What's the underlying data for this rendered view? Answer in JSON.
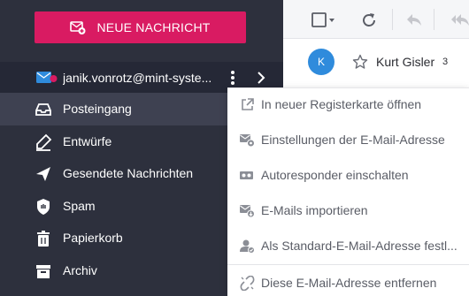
{
  "sidebar": {
    "new_message_label": "NEUE NACHRICHT",
    "account_email": "janik.vonrotz@mint-syste...",
    "items": [
      {
        "label": "Posteingang",
        "icon": "inbox-icon",
        "active": true
      },
      {
        "label": "Entwürfe",
        "icon": "drafts-icon",
        "active": false
      },
      {
        "label": "Gesendete Nachrichten",
        "icon": "send-icon",
        "active": false
      },
      {
        "label": "Spam",
        "icon": "hand-stop-icon",
        "active": false
      },
      {
        "label": "Papierkorb",
        "icon": "trash-icon",
        "active": false
      },
      {
        "label": "Archiv",
        "icon": "archive-icon",
        "active": false
      }
    ]
  },
  "message_list": {
    "first_row": {
      "avatar_letter": "K",
      "sender": "Kurt Gisler",
      "count": "3"
    }
  },
  "account_menu": {
    "items": [
      {
        "label": "In neuer Registerkarte öffnen",
        "icon": "external-link-icon"
      },
      {
        "label": "Einstellungen der E-Mail-Adresse",
        "icon": "mail-settings-icon"
      },
      {
        "label": "Autoresponder einschalten",
        "icon": "autoresponder-icon"
      },
      {
        "label": "E-Mails importieren",
        "icon": "mail-import-icon"
      },
      {
        "label": "Als Standard-E-Mail-Adresse festl...",
        "icon": "default-user-icon"
      },
      {
        "label": "Diese E-Mail-Adresse entfernen",
        "icon": "unlink-icon"
      }
    ]
  },
  "colors": {
    "accent": "#d91b62",
    "sidebar_bg": "#2d303d",
    "account_row_bg": "#252836",
    "active_item_bg": "#3e4151",
    "avatar_bg": "#2f8bdc"
  }
}
